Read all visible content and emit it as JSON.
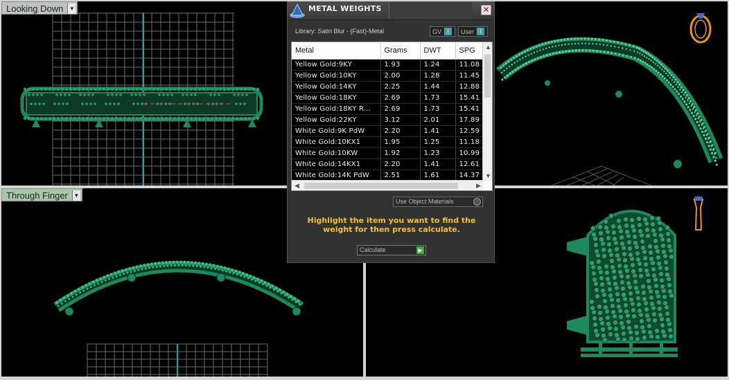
{
  "viewports": {
    "top_left": {
      "label": "Looking Down"
    },
    "bottom_left": {
      "label": "Through Finger"
    },
    "top_right": {
      "icon": "ring-orientation-icon"
    },
    "bottom_right": {
      "icon": "finger-orientation-icon"
    }
  },
  "colors": {
    "model_green": "#1e8a5c",
    "grid": "#6e6e6e",
    "axis_cyan": "#19a6b8",
    "hint_yellow": "#f2c12e"
  },
  "dialog": {
    "title": "METAL WEIGHTS",
    "close": "✕",
    "library": "Library: Satin Blur - (Fast)-Metal",
    "toggle_gv": "GV",
    "toggle_user": "User",
    "table": {
      "headers": [
        "Metal",
        "Grams",
        "DWT",
        "SPG"
      ],
      "rows": [
        [
          "Yellow Gold:9KY",
          "1.93",
          "1.24",
          "11.08"
        ],
        [
          "Yellow Gold:10KY",
          "2.00",
          "1.28",
          "11.45"
        ],
        [
          "Yellow Gold:14KY",
          "2.25",
          "1.44",
          "12.88"
        ],
        [
          "Yellow Gold:18KY",
          "2.69",
          "1.73",
          "15.41"
        ],
        [
          "Yellow Gold:18KY R...",
          "2.69",
          "1.73",
          "15.41"
        ],
        [
          "Yellow Gold:22KY",
          "3.12",
          "2.01",
          "17.89"
        ],
        [
          "White Gold:9K PdW",
          "2.20",
          "1.41",
          "12.59"
        ],
        [
          "White Gold:10KX1",
          "1.95",
          "1.25",
          "11.18"
        ],
        [
          "White Gold:10KW",
          "1.92",
          "1.23",
          "10.99"
        ],
        [
          "White Gold:14KX1",
          "2.20",
          "1.41",
          "12.61"
        ],
        [
          "White Gold:14K PdW",
          "2.51",
          "1.61",
          "14.37"
        ]
      ]
    },
    "use_object_materials": "Use Object Materials",
    "hint": "Highlight the item you want to find the weight for then press calculate.",
    "calculate": "Calculate"
  }
}
